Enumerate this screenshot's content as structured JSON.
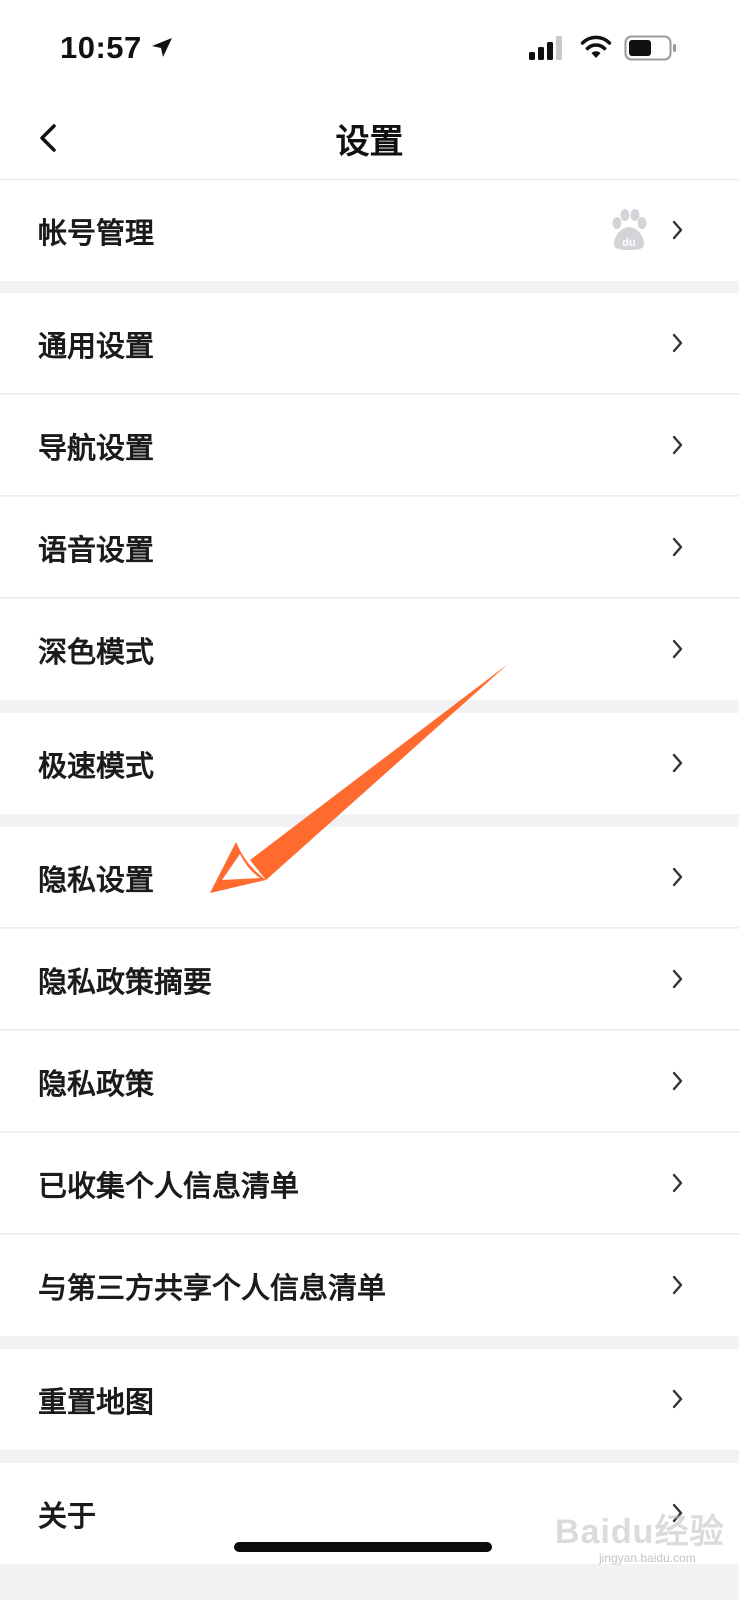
{
  "status_bar": {
    "time": "10:57",
    "icons": [
      "location-arrow-icon",
      "cellular-signal-icon",
      "wifi-icon",
      "battery-icon"
    ]
  },
  "header": {
    "title": "设置",
    "back_icon": "chevron-left-icon"
  },
  "settings": {
    "items": [
      {
        "label": "帐号管理",
        "icon": "baidu-paw-icon"
      },
      {
        "label": "通用设置"
      },
      {
        "label": "导航设置"
      },
      {
        "label": "语音设置"
      },
      {
        "label": "深色模式"
      },
      {
        "label": "极速模式"
      },
      {
        "label": "隐私设置"
      },
      {
        "label": "隐私政策摘要"
      },
      {
        "label": "隐私政策"
      },
      {
        "label": "已收集个人信息清单"
      },
      {
        "label": "与第三方共享个人信息清单"
      },
      {
        "label": "重置地图"
      },
      {
        "label": "关于"
      }
    ]
  },
  "annotation": {
    "arrow_color": "#ff6a2f",
    "points_to": "隐私设置"
  },
  "watermark": {
    "text": "Baidu经验",
    "sub": "jingyan.baidu.com"
  },
  "colors": {
    "background": "#f2f2f4",
    "row": "#ffffff",
    "text": "#1b1b1b",
    "chevron": "#333333"
  }
}
